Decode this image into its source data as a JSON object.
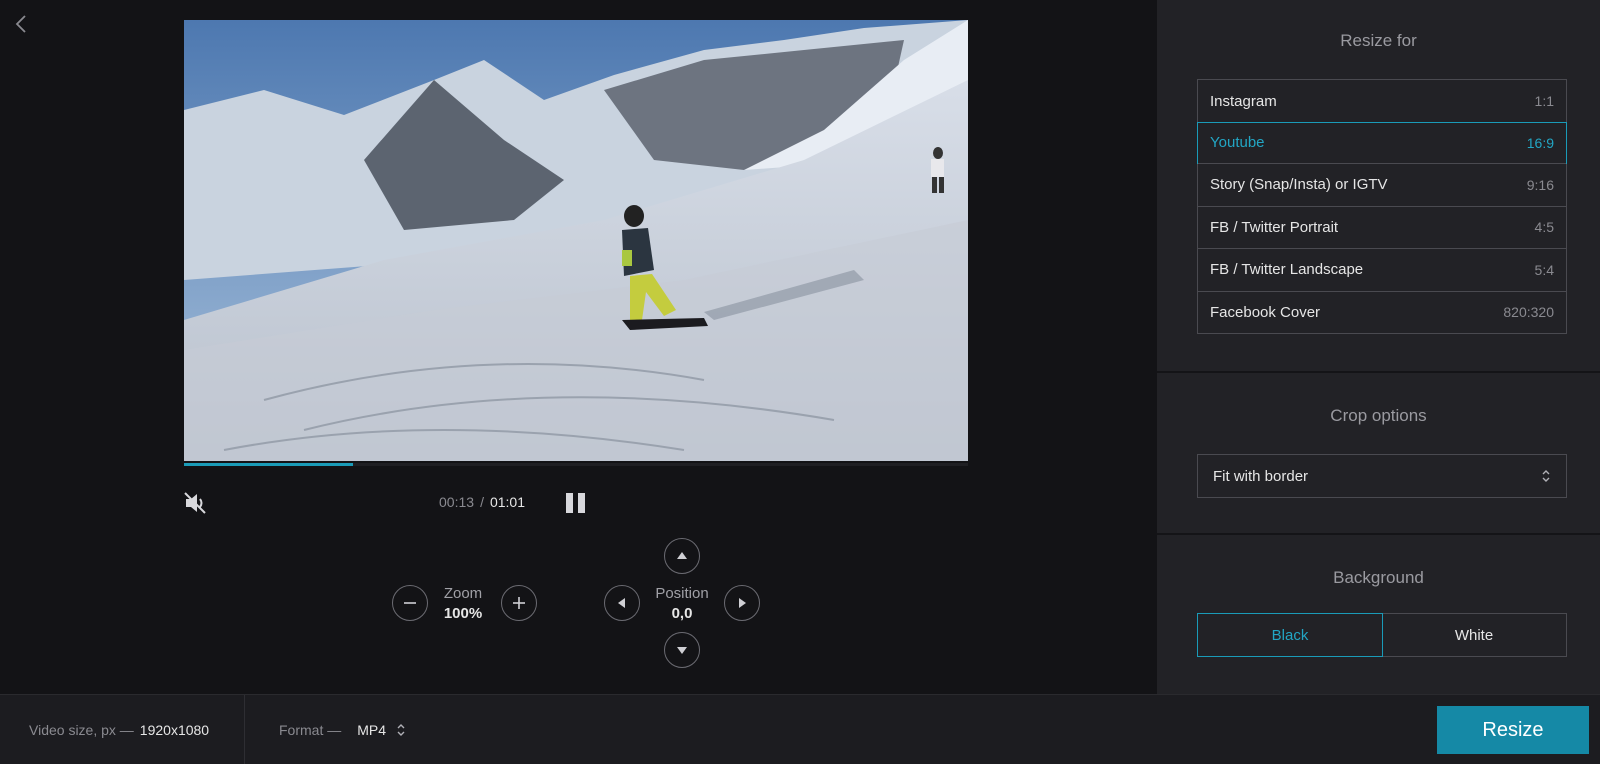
{
  "player": {
    "time_current": "00:13",
    "time_separator": "/",
    "time_total": "01:01",
    "progress_fraction": 0.215
  },
  "zoom": {
    "label": "Zoom",
    "value": "100%"
  },
  "position": {
    "label": "Position",
    "value": "0,0"
  },
  "resize_for": {
    "title": "Resize for",
    "presets": [
      {
        "label": "Instagram",
        "ratio": "1:1"
      },
      {
        "label": "Youtube",
        "ratio": "16:9",
        "active": true
      },
      {
        "label": "Story (Snap/Insta) or IGTV",
        "ratio": "9:16"
      },
      {
        "label": "FB / Twitter Portrait",
        "ratio": "4:5"
      },
      {
        "label": "FB / Twitter Landscape",
        "ratio": "5:4"
      },
      {
        "label": "Facebook Cover",
        "ratio": "820:320"
      }
    ]
  },
  "crop": {
    "title": "Crop options",
    "selected": "Fit with border"
  },
  "background": {
    "title": "Background",
    "options": [
      "Black",
      "White"
    ],
    "selected": "Black"
  },
  "footer": {
    "size_label": "Video size, px —",
    "size_value": "1920x1080",
    "format_label": "Format —",
    "format_value": "MP4",
    "resize_label": "Resize"
  },
  "colors": {
    "accent": "#1a9bb8",
    "button": "#1589a6"
  },
  "icons": [
    "back-arrow-icon",
    "mute-icon",
    "pause-icon",
    "minus-icon",
    "plus-icon",
    "arrow-up-icon",
    "arrow-down-icon",
    "arrow-left-icon",
    "arrow-right-icon",
    "sort-arrows-icon"
  ]
}
